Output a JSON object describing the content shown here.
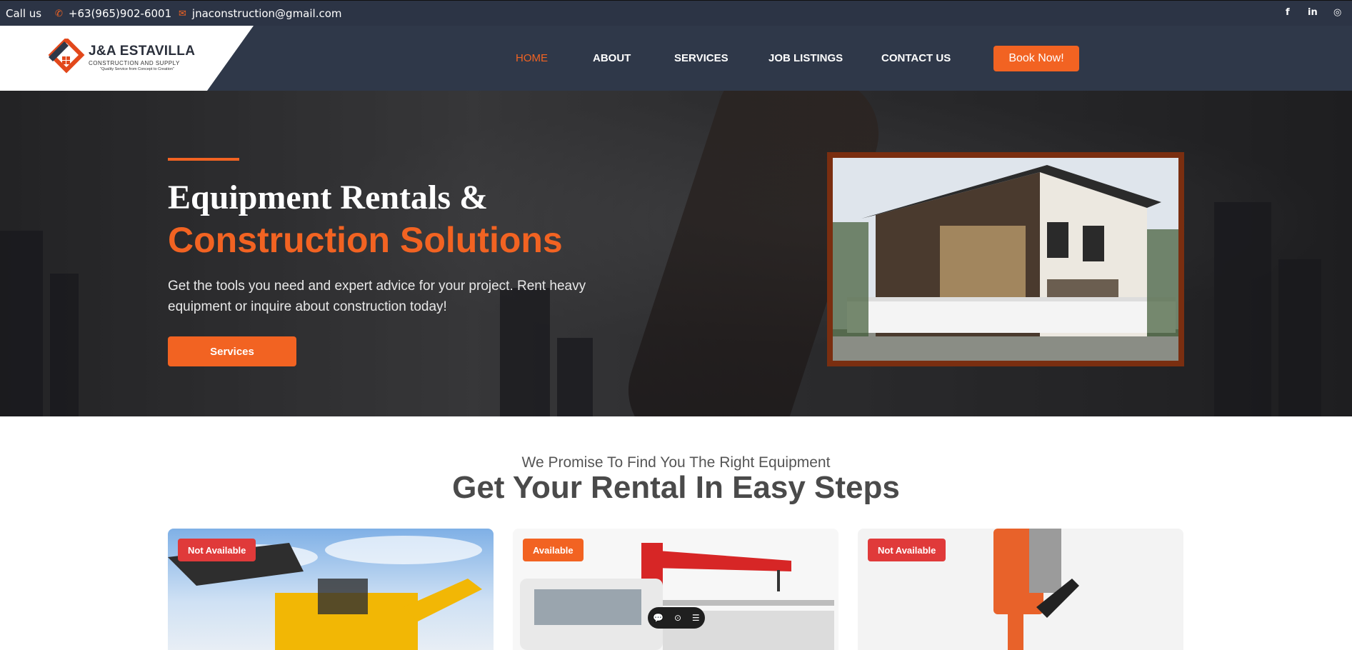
{
  "topbar": {
    "call_label": "Call us",
    "phone": "+63(965)902-6001",
    "email": "jnaconstruction@gmail.com",
    "social": [
      "f",
      "in",
      "◎"
    ]
  },
  "brand": {
    "name": "J&A ESTAVILLA",
    "subtitle": "CONSTRUCTION AND SUPPLY",
    "tagline": "\"Quality Service from Concept to Creation\""
  },
  "nav": {
    "items": [
      "HOME",
      "ABOUT",
      "SERVICES",
      "JOB LISTINGS",
      "CONTACT US"
    ],
    "active": "HOME",
    "cta": "Book Now!"
  },
  "hero": {
    "title_line1": "Equipment Rentals &",
    "title_line2": "Construction Solutions",
    "description": "Get the tools you need and expert advice for your project. Rent heavy equipment or inquire about construction today!",
    "button": "Services"
  },
  "section": {
    "subtitle": "We Promise To Find You The Right Equipment",
    "title": "Get Your Rental In Easy Steps"
  },
  "cards": [
    {
      "status": "Not Available",
      "image": "backhoe-loader"
    },
    {
      "status": "Available",
      "image": "boom-truck"
    },
    {
      "status": "Not Available",
      "image": "jackhammer"
    }
  ],
  "colors": {
    "accent": "#f26322",
    "topbar": "#2c3445",
    "navbar": "#2f3849",
    "not_available": "#e03a3a"
  }
}
